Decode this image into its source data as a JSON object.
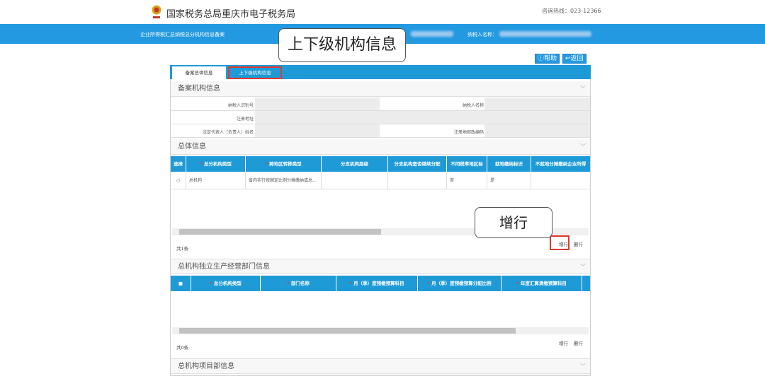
{
  "header": {
    "site_title": "国家税务总局重庆市电子税务局",
    "hotline": "咨询热线：023-12366"
  },
  "nav": {
    "breadcrumb": "企业所得税汇总纳税总分机构信息备案",
    "taxpayer_name_label": "纳税人名称："
  },
  "actions": {
    "help": "帮助",
    "back": "返回"
  },
  "tabs": [
    {
      "label": "备案总体信息"
    },
    {
      "label": "上下级机构信息"
    }
  ],
  "callouts": {
    "tab": "上下级机构信息",
    "add_row": "增行"
  },
  "filing_info": {
    "title": "备案机构信息",
    "fields": {
      "taxpayer_id": "纳税人识别号",
      "taxpayer_name": "纳税人名称",
      "reg_address": "注册地址",
      "legal_rep": "法定代表人（负责人）姓名",
      "postal_code": "注册地邮政编码"
    }
  },
  "overall": {
    "title": "总体信息",
    "columns": [
      "选择",
      "总分机构类型",
      "跨地区转移类型",
      "分支机构层级",
      "分支机构是否继续分配",
      "不同税率地区标",
      "就地缴纳标识",
      "不就地分摊缴纳企业所得"
    ],
    "rows": [
      {
        "type": "总机构",
        "transfer": "省内实行按固定比例分摊缴纳或总...",
        "level": "",
        "continue": "",
        "rate_flag": "否",
        "local_flag": "是",
        "other": ""
      }
    ],
    "count": "共1条",
    "add": "增行",
    "delete": "删行"
  },
  "departments": {
    "title": "总机构独立生产经营部门信息",
    "columns": [
      "总分机构类型",
      "部门名称",
      "月（季）度预缴预算科目",
      "月（季）度预缴预算分配比例",
      "年度汇算清缴预算科目"
    ],
    "count": "共0条",
    "add": "增行",
    "delete": "删行"
  },
  "projects": {
    "title": "总机构项目部信息"
  }
}
